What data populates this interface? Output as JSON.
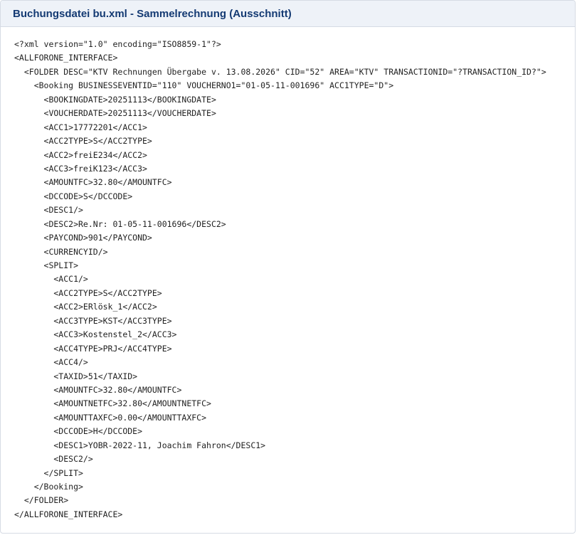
{
  "panel": {
    "title": "Buchungsdatei bu.xml - Sammelrechnung (Ausschnitt)"
  },
  "code": {
    "lines": [
      "<?xml version=\"1.0\" encoding=\"ISO8859-1\"?>",
      "<ALLFORONE_INTERFACE>",
      "  <FOLDER DESC=\"KTV Rechnungen Übergabe v. 13.08.2026\" CID=\"52\" AREA=\"KTV\" TRANSACTIONID=\"?TRANSACTION_ID?\">",
      "    <Booking BUSINESSEVENTID=\"110\" VOUCHERNO1=\"01-05-11-001696\" ACC1TYPE=\"D\">",
      "      <BOOKINGDATE>20251113</BOOKINGDATE>",
      "      <VOUCHERDATE>20251113</VOUCHERDATE>",
      "      <ACC1>17772201</ACC1>",
      "      <ACC2TYPE>S</ACC2TYPE>",
      "      <ACC2>freiE234</ACC2>",
      "      <ACC3>freiK123</ACC3>",
      "      <AMOUNTFC>32.80</AMOUNTFC>",
      "      <DCCODE>S</DCCODE>",
      "      <DESC1/>",
      "      <DESC2>Re.Nr: 01-05-11-001696</DESC2>",
      "      <PAYCOND>901</PAYCOND>",
      "      <CURRENCYID/>",
      "      <SPLIT>",
      "        <ACC1/>",
      "        <ACC2TYPE>S</ACC2TYPE>",
      "        <ACC2>ERlösk_1</ACC2>",
      "        <ACC3TYPE>KST</ACC3TYPE>",
      "        <ACC3>Kostenstel_2</ACC3>",
      "        <ACC4TYPE>PRJ</ACC4TYPE>",
      "        <ACC4/>",
      "        <TAXID>51</TAXID>",
      "        <AMOUNTFC>32.80</AMOUNTFC>",
      "        <AMOUNTNETFC>32.80</AMOUNTNETFC>",
      "        <AMOUNTTAXFC>0.00</AMOUNTTAXFC>",
      "        <DCCODE>H</DCCODE>",
      "        <DESC1>YOBR-2022-11, Joachim Fahron</DESC1>",
      "        <DESC2/>",
      "      </SPLIT>",
      "    </Booking>",
      "  </FOLDER>",
      "</ALLFORONE_INTERFACE>"
    ]
  },
  "colors": {
    "title": "#143a73",
    "header_background": "#eef2f8",
    "border": "#d6dbe4",
    "code_text": "#222222"
  }
}
